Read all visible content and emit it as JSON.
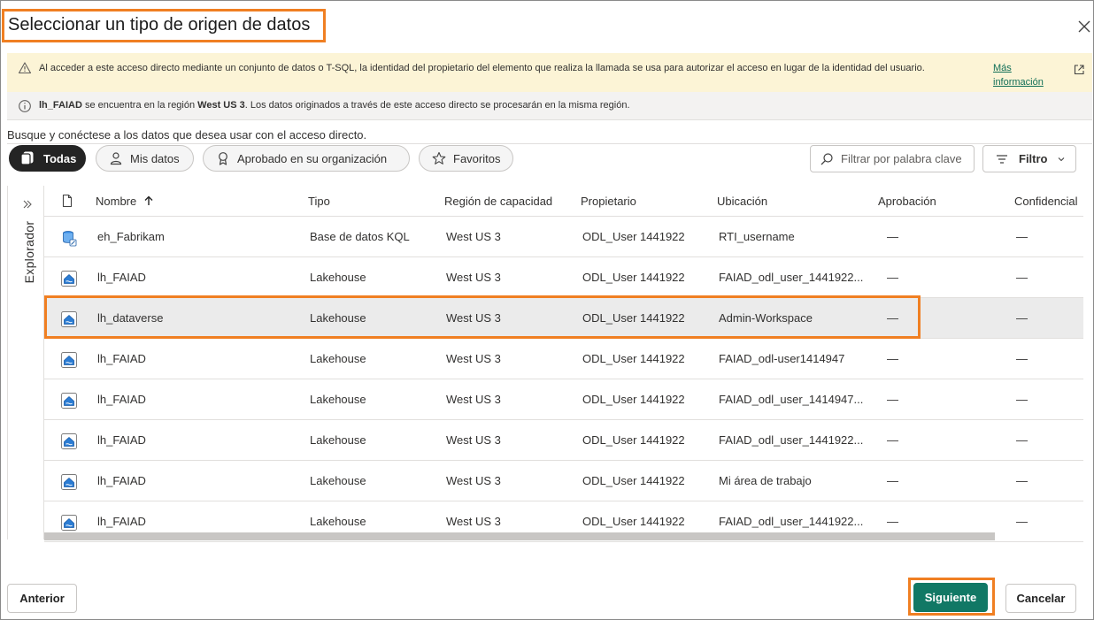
{
  "dialog": {
    "title": "Seleccionar un tipo de origen de datos",
    "close_icon": "close-icon"
  },
  "warning": {
    "icon": "warning-icon",
    "text": "Al acceder a este acceso directo mediante un conjunto de datos o T-SQL, la identidad del propietario del elemento que realiza la llamada se usa para autorizar el acceso en lugar de la identidad del usuario.",
    "link": "Más información",
    "link_icon": "open-external-icon"
  },
  "info": {
    "icon": "info-icon",
    "item_name": "lh_FAIAD",
    "middle": " se encuentra en la región ",
    "region": "West US 3",
    "tail": ". Los datos originados a través de este acceso directo se procesarán en la misma región."
  },
  "intro": "Busque y conéctese a los datos que desea usar con el acceso directo.",
  "filters": [
    {
      "label": "Todas",
      "icon": "all-items-icon",
      "active": true
    },
    {
      "label": "Mis datos",
      "icon": "person-icon",
      "active": false
    },
    {
      "label": "Aprobado en su organización",
      "icon": "ribbon-icon",
      "active": false
    },
    {
      "label": "Favoritos",
      "icon": "star-icon",
      "active": false
    }
  ],
  "search": {
    "placeholder": "Filtrar por palabra clave",
    "icon": "search-icon"
  },
  "filter_button": {
    "label": "Filtro",
    "icon": "filter-lines-icon",
    "chevron": "chevron-down-icon"
  },
  "explorer": {
    "label": "Explorador",
    "toggle_icon": "double-chevron-right-icon"
  },
  "table": {
    "columns": [
      "Nombre",
      "Tipo",
      "Región de capacidad",
      "Propietario",
      "Ubicación",
      "Aprobación",
      "Confidencial"
    ],
    "sort_icon": "sort-arrow-up-icon",
    "type_column_icon": "document-icon",
    "rows": [
      {
        "name": "eh_Fabrikam",
        "type": "Base de datos KQL",
        "region": "West US 3",
        "owner": "ODL_User 1441922",
        "location": "RTI_username",
        "approval": "—",
        "sensitivity": "—",
        "icon": "kql-database-icon",
        "selected": false
      },
      {
        "name": "lh_FAIAD",
        "type": "Lakehouse",
        "region": "West US 3",
        "owner": "ODL_User 1441922",
        "location": "FAIAD_odl_user_1441922...",
        "approval": "—",
        "sensitivity": "—",
        "icon": "lakehouse-icon",
        "selected": false
      },
      {
        "name": "lh_dataverse",
        "type": "Lakehouse",
        "region": "West US 3",
        "owner": "ODL_User 1441922",
        "location": "Admin-Workspace",
        "approval": "—",
        "sensitivity": "—",
        "icon": "lakehouse-icon",
        "selected": true
      },
      {
        "name": "lh_FAIAD",
        "type": "Lakehouse",
        "region": "West US 3",
        "owner": "ODL_User 1441922",
        "location": "FAIAD_odl-user1414947",
        "approval": "—",
        "sensitivity": "—",
        "icon": "lakehouse-icon",
        "selected": false
      },
      {
        "name": "lh_FAIAD",
        "type": "Lakehouse",
        "region": "West US 3",
        "owner": "ODL_User 1441922",
        "location": "FAIAD_odl_user_1414947...",
        "approval": "—",
        "sensitivity": "—",
        "icon": "lakehouse-icon",
        "selected": false
      },
      {
        "name": "lh_FAIAD",
        "type": "Lakehouse",
        "region": "West US 3",
        "owner": "ODL_User 1441922",
        "location": "FAIAD_odl_user_1441922...",
        "approval": "—",
        "sensitivity": "—",
        "icon": "lakehouse-icon",
        "selected": false
      },
      {
        "name": "lh_FAIAD",
        "type": "Lakehouse",
        "region": "West US 3",
        "owner": "ODL_User 1441922",
        "location": "Mi área de trabajo",
        "approval": "—",
        "sensitivity": "—",
        "icon": "lakehouse-icon",
        "selected": false
      },
      {
        "name": "lh_FAIAD",
        "type": "Lakehouse",
        "region": "West US 3",
        "owner": "ODL_User 1441922",
        "location": "FAIAD_odl_user_1441922...",
        "approval": "—",
        "sensitivity": "—",
        "icon": "lakehouse-icon",
        "selected": false
      }
    ]
  },
  "footer": {
    "back": "Anterior",
    "next": "Siguiente",
    "cancel": "Cancelar"
  },
  "colors": {
    "accent": "#117865",
    "highlight": "#f07f22",
    "warning_bg": "#fcf4d6",
    "info_bg": "#f3f2f1"
  }
}
